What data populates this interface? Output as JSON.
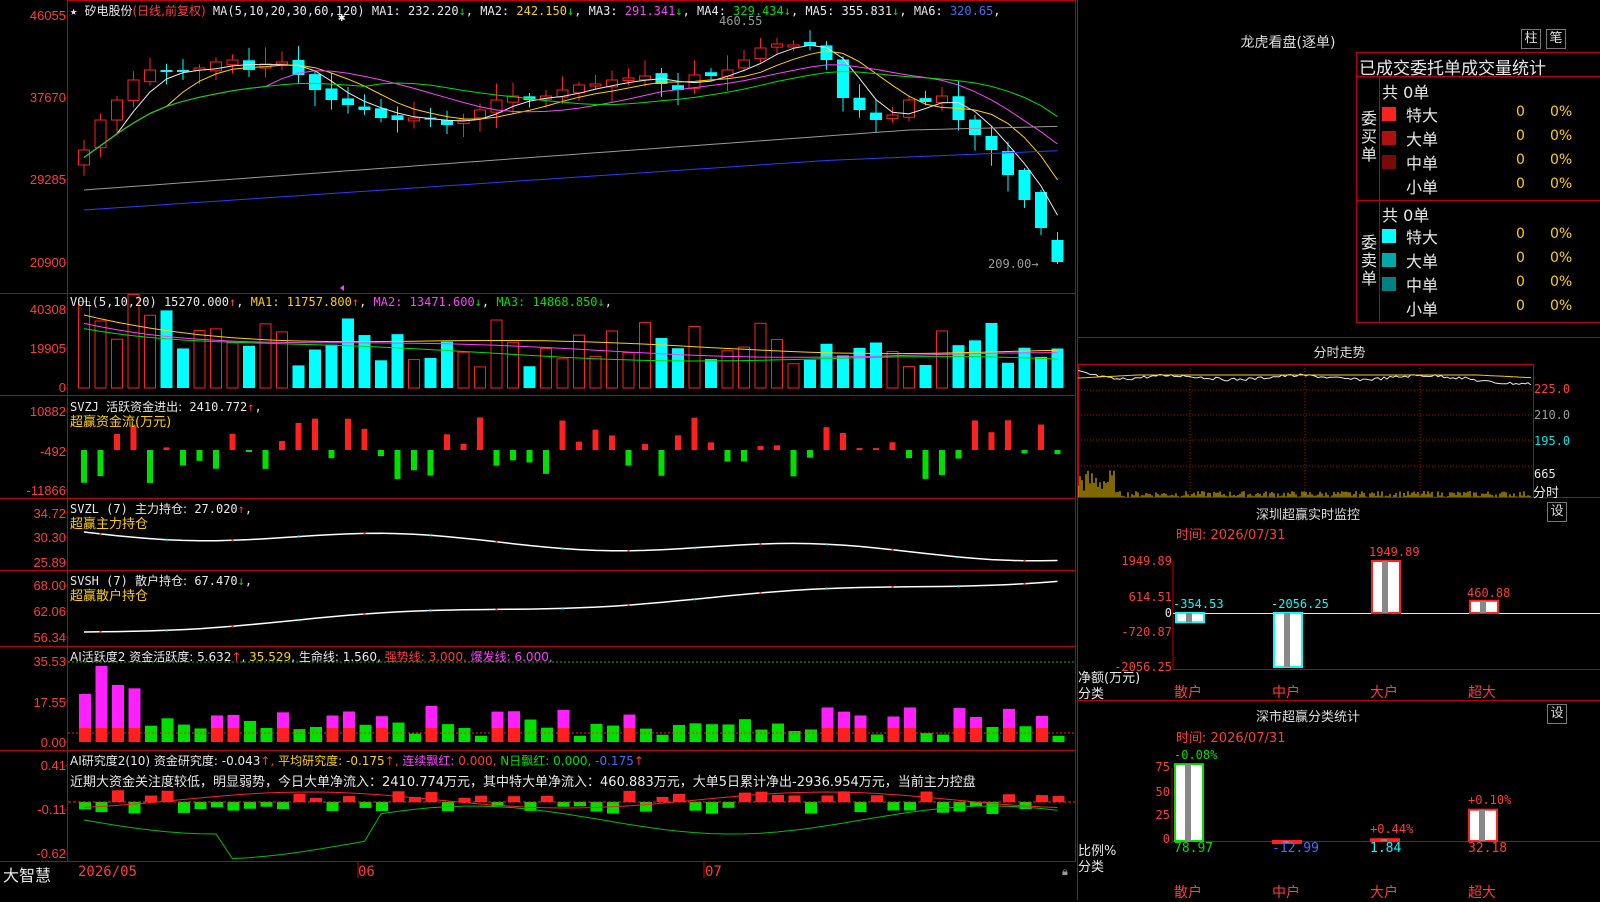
{
  "brand": "大智慧",
  "stock": {
    "name": "矽电股份",
    "mode": "(日线,前复权)",
    "ma_label": "MA(5,10,20,30,60,120)",
    "ma": [
      {
        "label": "MA1:",
        "value": "232.220",
        "arrow": "↓",
        "color": "#e8e8e8"
      },
      {
        "label": "MA2:",
        "value": "242.150",
        "arrow": "↓",
        "color": "#ffd000"
      },
      {
        "label": "MA3:",
        "value": "291.341",
        "arrow": "↓",
        "color": "#ff40ff"
      },
      {
        "label": "MA4:",
        "value": "329.434",
        "arrow": "↓",
        "color": "#00e000"
      },
      {
        "label": "MA5:",
        "value": "355.831",
        "arrow": "↓",
        "color": "#e8e8e8"
      },
      {
        "label": "MA6:",
        "value": "320.65",
        "arrow": "",
        "color": "#4a6bff"
      }
    ],
    "high_mark": "460.55",
    "low_mark": "209.00"
  },
  "price_axis": [
    "46055",
    "37670",
    "29285",
    "20900"
  ],
  "vol": {
    "label": "VOL(5,10,20)",
    "value": "15270.000",
    "arrow": "↑",
    "ma": [
      {
        "label": "MA1:",
        "value": "11757.800",
        "arrow": "↑",
        "color": "#ffd000"
      },
      {
        "label": "MA2:",
        "value": "13471.600",
        "arrow": "↓",
        "color": "#ff40ff"
      },
      {
        "label": "MA3:",
        "value": "14868.850",
        "arrow": "↓",
        "color": "#00e000"
      }
    ],
    "axis": [
      "40308",
      "19905",
      "0"
    ]
  },
  "svzj": {
    "label": "SVZJ",
    "item": "活跃资金进出:",
    "value": "2410.772",
    "arrow": "↑",
    "sub": "超赢资金流(万元)",
    "axis": [
      "10882",
      "-492",
      "-11866"
    ]
  },
  "svzl": {
    "label": "SVZL (7)",
    "item": "主力持仓:",
    "value": "27.020",
    "arrow": "↑",
    "sub": "超赢主力持仓",
    "axis": [
      "34.72",
      "30.30",
      "25.89"
    ]
  },
  "svsh": {
    "label": "SVSH (7)",
    "item": "散户持仓:",
    "value": "67.470",
    "arrow": "↓",
    "sub": "超赢散户持仓",
    "axis": [
      "68.00",
      "62.06",
      "56.34"
    ]
  },
  "ai_active": {
    "label": "AI活跃度2",
    "item1": "资金活跃度:",
    "v1": "5.632",
    "a1": "↑",
    "v2": "35.529",
    "item3": "生命线:",
    "v3": "1.560",
    "item4": "强势线:",
    "v4": "3.000",
    "item5": "爆发线:",
    "v5": "6.000",
    "axis": [
      "35.53",
      "17.55",
      "0.00"
    ]
  },
  "ai_research": {
    "label": "AI研究度2(10)",
    "item1": "资金研究度:",
    "v1": "-0.043",
    "item2": "平均研究度:",
    "v2": "-0.175",
    "item3": "连续飘红:",
    "v3": "0.000",
    "item4": "N日飘红:",
    "v4": "0.000",
    "v5": "-0.175",
    "note": "近期大资金关注度较低，明显弱势，今日大单净流入：2410.774万元，其中特大单净流入：460.883万元，大单5日累计净出-2936.954万元，当前主力控盘",
    "axis": [
      "0.41",
      "-0.11",
      "-0.62"
    ]
  },
  "x_axis": [
    "2026/05",
    "06",
    "07"
  ],
  "lhb": {
    "title": "龙虎看盘(逐单)",
    "btn1": "柱",
    "btn2": "笔",
    "tab": "已成交委托单成交量统计",
    "buy_side": "委买单",
    "sell_side": "委卖单",
    "buy_total": "共 0单",
    "sell_total": "共 0单",
    "buy_rows": [
      {
        "label": "特大",
        "count": "0",
        "pct": "0%",
        "color": "#ff2020"
      },
      {
        "label": "大单",
        "count": "0",
        "pct": "0%",
        "color": "#b01010"
      },
      {
        "label": "中单",
        "count": "0",
        "pct": "0%",
        "color": "#7a0a0a"
      },
      {
        "label": "小单",
        "count": "0",
        "pct": "0%",
        "color": "#000000"
      }
    ],
    "sell_rows": [
      {
        "label": "特大",
        "count": "0",
        "pct": "0%",
        "color": "#00ffff"
      },
      {
        "label": "大单",
        "count": "0",
        "pct": "0%",
        "color": "#00a8a8"
      },
      {
        "label": "中单",
        "count": "0",
        "pct": "0%",
        "color": "#008080"
      },
      {
        "label": "小单",
        "count": "0",
        "pct": "0%",
        "color": "#000000"
      }
    ]
  },
  "intraday": {
    "title": "分时走势",
    "axis": [
      "225.0",
      "210.0",
      "195.0",
      "665"
    ],
    "vol_unit": "分时"
  },
  "sz_monitor": {
    "title": "深圳超赢实时监控",
    "btn": "设",
    "time_label": "时间:",
    "time": "2026/07/31",
    "axis": [
      "1949.89",
      "614.51",
      "0",
      "-720.87",
      "-2056.25"
    ],
    "axis_label": "净额(万元)",
    "cat_label": "分类",
    "categories": [
      "散户",
      "中户",
      "大户",
      "超大"
    ],
    "values": [
      "-354.53",
      "-2056.25",
      "1949.89",
      "460.88"
    ]
  },
  "sz_class": {
    "title": "深市超赢分类统计",
    "btn": "设",
    "time_label": "时间:",
    "time": "2026/07/31",
    "axis": [
      "75",
      "50",
      "25",
      "0"
    ],
    "axis_label": "比例%",
    "cat_label": "分类",
    "categories": [
      "散户",
      "中户",
      "大户",
      "超大"
    ],
    "bottom": [
      "78.97",
      "-12.99",
      "1.84",
      "32.18"
    ],
    "top": [
      "-0.08%",
      "",
      "+0.44%",
      "+0.10%"
    ]
  },
  "chart_data": [
    {
      "type": "candlestick",
      "title": "矽电股份(日线,前复权)",
      "y_ticks": [
        46055,
        37670,
        29285,
        20900
      ],
      "x_ticks": [
        "2026/05",
        "06",
        "07"
      ],
      "high": 460.55,
      "low": 209.0,
      "series": [
        {
          "name": "MA1",
          "value": 232.22
        },
        {
          "name": "MA2",
          "value": 242.15
        },
        {
          "name": "MA3",
          "value": 291.341
        },
        {
          "name": "MA4",
          "value": 329.434
        },
        {
          "name": "MA5",
          "value": 355.831
        },
        {
          "name": "MA6",
          "value": 320.65
        }
      ]
    },
    {
      "type": "bar",
      "title": "深圳超赢实时监控",
      "categories": [
        "散户",
        "中户",
        "大户",
        "超大"
      ],
      "values": [
        -354.53,
        -2056.25,
        1949.89,
        460.88
      ],
      "ylabel": "净额(万元)",
      "ylim": [
        -2056.25,
        1949.89
      ]
    },
    {
      "type": "bar",
      "title": "深市超赢分类统计",
      "categories": [
        "散户",
        "中户",
        "大户",
        "超大"
      ],
      "values": [
        78.97,
        -12.99,
        1.84,
        32.18
      ],
      "ylabel": "比例%",
      "ylim": [
        0,
        75
      ]
    }
  ]
}
